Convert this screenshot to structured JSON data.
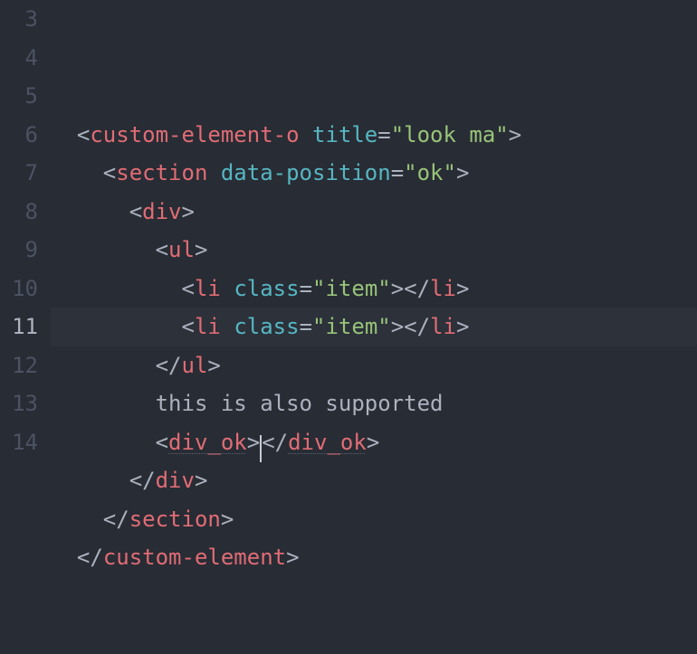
{
  "lines": [
    {
      "num": "3",
      "indent": 1,
      "parts": [
        {
          "t": "<",
          "c": "p"
        },
        {
          "t": "custom-element-o",
          "c": "tg"
        },
        {
          "t": " ",
          "c": "p"
        },
        {
          "t": "title",
          "c": "at2"
        },
        {
          "t": "=",
          "c": "p"
        },
        {
          "t": "\"look ma\"",
          "c": "st"
        },
        {
          "t": ">",
          "c": "p"
        }
      ]
    },
    {
      "num": "4",
      "indent": 2,
      "parts": [
        {
          "t": "<",
          "c": "p"
        },
        {
          "t": "section",
          "c": "tg"
        },
        {
          "t": " ",
          "c": "p"
        },
        {
          "t": "data-position",
          "c": "at2"
        },
        {
          "t": "=",
          "c": "p"
        },
        {
          "t": "\"ok\"",
          "c": "st"
        },
        {
          "t": ">",
          "c": "p"
        }
      ]
    },
    {
      "num": "5",
      "indent": 3,
      "parts": [
        {
          "t": "<",
          "c": "p"
        },
        {
          "t": "div",
          "c": "tg"
        },
        {
          "t": ">",
          "c": "p"
        }
      ]
    },
    {
      "num": "6",
      "indent": 4,
      "parts": [
        {
          "t": "<",
          "c": "p"
        },
        {
          "t": "ul",
          "c": "tg"
        },
        {
          "t": ">",
          "c": "p"
        }
      ]
    },
    {
      "num": "7",
      "indent": 5,
      "parts": [
        {
          "t": "<",
          "c": "p"
        },
        {
          "t": "li",
          "c": "tg"
        },
        {
          "t": " ",
          "c": "p"
        },
        {
          "t": "class",
          "c": "at2"
        },
        {
          "t": "=",
          "c": "p"
        },
        {
          "t": "\"item\"",
          "c": "st"
        },
        {
          "t": "></",
          "c": "p"
        },
        {
          "t": "li",
          "c": "tg"
        },
        {
          "t": ">",
          "c": "p"
        }
      ]
    },
    {
      "num": "8",
      "indent": 5,
      "parts": [
        {
          "t": "<",
          "c": "p"
        },
        {
          "t": "li",
          "c": "tg"
        },
        {
          "t": " ",
          "c": "p"
        },
        {
          "t": "class",
          "c": "at2"
        },
        {
          "t": "=",
          "c": "p"
        },
        {
          "t": "\"item\"",
          "c": "st"
        },
        {
          "t": "></",
          "c": "p"
        },
        {
          "t": "li",
          "c": "tg"
        },
        {
          "t": ">",
          "c": "p"
        }
      ]
    },
    {
      "num": "9",
      "indent": 4,
      "parts": [
        {
          "t": "</",
          "c": "p"
        },
        {
          "t": "ul",
          "c": "tg"
        },
        {
          "t": ">",
          "c": "p"
        }
      ]
    },
    {
      "num": "10",
      "indent": 4,
      "parts": [
        {
          "t": "this is also supported",
          "c": "tx"
        }
      ]
    },
    {
      "num": "11",
      "indent": 4,
      "cursor": true,
      "parts_before": [
        {
          "t": "<",
          "c": "p"
        },
        {
          "t": "div_ok",
          "c": "tg sq"
        },
        {
          "t": ">",
          "c": "p"
        }
      ],
      "parts_after": [
        {
          "t": "</",
          "c": "p"
        },
        {
          "t": "div_ok",
          "c": "tg sq"
        },
        {
          "t": ">",
          "c": "p"
        }
      ]
    },
    {
      "num": "12",
      "indent": 3,
      "parts": [
        {
          "t": "</",
          "c": "p"
        },
        {
          "t": "div",
          "c": "tg"
        },
        {
          "t": ">",
          "c": "p"
        }
      ]
    },
    {
      "num": "13",
      "indent": 2,
      "parts": [
        {
          "t": "</",
          "c": "p"
        },
        {
          "t": "section",
          "c": "tg"
        },
        {
          "t": ">",
          "c": "p"
        }
      ]
    },
    {
      "num": "14",
      "indent": 1,
      "parts": [
        {
          "t": "</",
          "c": "p"
        },
        {
          "t": "custom-element",
          "c": "tg"
        },
        {
          "t": ">",
          "c": "p"
        }
      ]
    }
  ],
  "indent_unit": "  ",
  "active_line_index": 8,
  "colors": {
    "bg": "#282c34",
    "fg": "#abb2bf",
    "tag": "#e06c75",
    "attr": "#56b6c2",
    "string": "#98c379",
    "gutter": "#4b5263",
    "active": "#2c313a"
  }
}
